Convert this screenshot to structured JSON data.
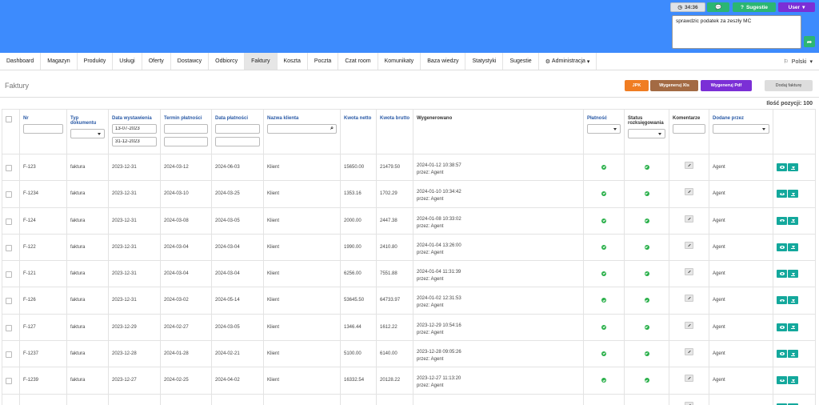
{
  "topbar": {
    "timer": "34:36",
    "suggestions_label": "Sugestie",
    "user_label": "User",
    "note_text": "sprawdzic podatek za zeszły MC"
  },
  "nav": {
    "items": [
      "Dashboard",
      "Magazyn",
      "Produkty",
      "Usługi",
      "Oferty",
      "Dostawcy",
      "Odbiorcy",
      "Faktury",
      "Koszta",
      "Poczta",
      "Czat room",
      "Komunikaty",
      "Baza wiedzy",
      "Statystyki",
      "Sugestie",
      "Administracja"
    ],
    "active": "Faktury",
    "language": "Polski"
  },
  "page": {
    "title": "Faktury",
    "count_label": "Ilość pozycji: 100"
  },
  "actions": {
    "jpk": "JPK",
    "xls": "Wygeneruj Xls",
    "pdf": "Wygeneruj Pdf",
    "add": "Dodaj fakturę"
  },
  "table": {
    "headers": {
      "nr": "Nr",
      "typ": "Typ dokumentu",
      "data_wyst": "Data wystawienia",
      "termin": "Termin płatności",
      "data_plat": "Data płatności",
      "klient": "Nazwa klienta",
      "netto": "Kwota netto",
      "brutto": "Kwota brutto",
      "wygen": "Wygenerowano",
      "platnosc": "Płatność",
      "status": "Status rozksięgowania",
      "komentarze": "Komentarze",
      "dodane": "Dodane przez"
    },
    "filters": {
      "date_from": "13-07-2023",
      "date_to": "31-12-2023"
    },
    "rows": [
      {
        "nr": "F-123",
        "typ": "faktura",
        "wyst": "2023-12-31",
        "termin": "2024-03-12",
        "plat": "2024-06-03",
        "klient": "Klient",
        "netto": "15650.00",
        "brutto": "21479.50",
        "gen": "2024-01-12 10:38:57",
        "by": "przez: Agent",
        "dodane": "Agent"
      },
      {
        "nr": "F-1234",
        "typ": "faktura",
        "wyst": "2023-12-31",
        "termin": "2024-03-10",
        "plat": "2024-03-25",
        "klient": "Klient",
        "netto": "1353.16",
        "brutto": "1702.29",
        "gen": "2024-01-10 10:34:42",
        "by": "przez: Agent",
        "dodane": "Agent"
      },
      {
        "nr": "F-124",
        "typ": "faktura",
        "wyst": "2023-12-31",
        "termin": "2024-03-08",
        "plat": "2024-03-05",
        "klient": "Klient",
        "netto": "2000.00",
        "brutto": "2447.38",
        "gen": "2024-01-08 10:33:02",
        "by": "przez: Agent",
        "dodane": "Agent"
      },
      {
        "nr": "F-122",
        "typ": "faktura",
        "wyst": "2023-12-31",
        "termin": "2024-03-04",
        "plat": "2024-03-04",
        "klient": "Klient",
        "netto": "1990.00",
        "brutto": "2410.80",
        "gen": "2024-01-04 13:26:00",
        "by": "przez: Agent",
        "dodane": "Agent"
      },
      {
        "nr": "F-121",
        "typ": "faktura",
        "wyst": "2023-12-31",
        "termin": "2024-03-04",
        "plat": "2024-03-04",
        "klient": "Klient",
        "netto": "6256.00",
        "brutto": "7551.88",
        "gen": "2024-01-04 11:31:39",
        "by": "przez: Agent",
        "dodane": "Agent"
      },
      {
        "nr": "F-126",
        "typ": "faktura",
        "wyst": "2023-12-31",
        "termin": "2024-03-02",
        "plat": "2024-05-14",
        "klient": "Klient",
        "netto": "53645.50",
        "brutto": "64733.97",
        "gen": "2024-01-02 12:31:53",
        "by": "przez: Agent",
        "dodane": "Agent"
      },
      {
        "nr": "F-127",
        "typ": "faktura",
        "wyst": "2023-12-29",
        "termin": "2024-02-27",
        "plat": "2024-03-05",
        "klient": "Klient",
        "netto": "1346.44",
        "brutto": "1612.22",
        "gen": "2023-12-29 10:54:16",
        "by": "przez: Agent",
        "dodane": "Agent"
      },
      {
        "nr": "F-1237",
        "typ": "faktura",
        "wyst": "2023-12-28",
        "termin": "2024-01-28",
        "plat": "2024-02-21",
        "klient": "Klient",
        "netto": "5100.00",
        "brutto": "6140.00",
        "gen": "2023-12-28 09:05:26",
        "by": "przez: Agent",
        "dodane": "Agent"
      },
      {
        "nr": "F-1239",
        "typ": "faktura",
        "wyst": "2023-12-27",
        "termin": "2024-02-25",
        "plat": "2024-04-02",
        "klient": "Klient",
        "netto": "16332.54",
        "brutto": "20128.22",
        "gen": "2023-12-27 11:13:20",
        "by": "przez: Agent",
        "dodane": "Agent"
      },
      {
        "nr": "",
        "typ": "",
        "wyst": "",
        "termin": "",
        "plat": "",
        "klient": "",
        "netto": "",
        "brutto": "",
        "gen": "",
        "by": "",
        "dodane": ""
      }
    ]
  }
}
